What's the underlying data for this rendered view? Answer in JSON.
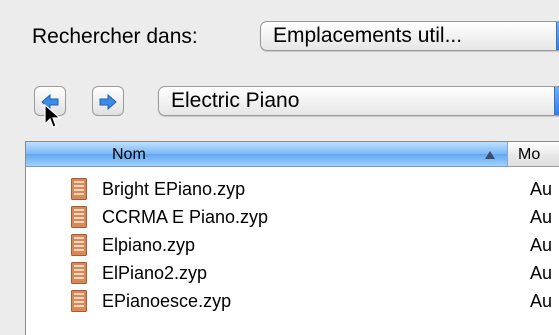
{
  "search": {
    "label": "Rechercher dans:",
    "selected": "Emplacements util..."
  },
  "navigation": {
    "back_icon": "arrow-left-icon",
    "forward_icon": "arrow-right-icon",
    "location": "Electric Piano"
  },
  "table": {
    "columns": [
      "Nom",
      "Mo"
    ],
    "sort_direction": "ascending",
    "rows": [
      {
        "name": "Bright EPiano.zyp",
        "modified": "Au"
      },
      {
        "name": "CCRMA E Piano.zyp",
        "modified": "Au"
      },
      {
        "name": "Elpiano.zyp",
        "modified": "Au"
      },
      {
        "name": "ElPiano2.zyp",
        "modified": "Au"
      },
      {
        "name": "EPianoesce.zyp",
        "modified": "Au"
      }
    ]
  },
  "colors": {
    "accent": "#3b86e6",
    "selected_header": "#7cb8f5",
    "file_icon": "#d9885a"
  }
}
